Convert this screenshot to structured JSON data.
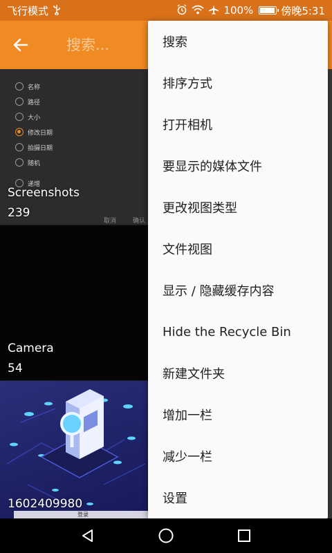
{
  "status": {
    "airplane_mode": "飞行模式",
    "usb_icon": "usb-icon",
    "battery": "100%",
    "battery_level": 1.0,
    "time": "傍晚5:31",
    "icons": [
      "alarm-icon",
      "wifi-icon",
      "airplane-icon"
    ]
  },
  "appbar": {
    "search_placeholder": "搜索...",
    "back_icon": "arrow-left-icon"
  },
  "colors": {
    "status_bar": "#d9711a",
    "app_bar": "#f08a23",
    "accent": "#f08a23",
    "menu_bg": "#fafafa"
  },
  "folders": [
    {
      "name": "Screenshots",
      "count": "239"
    },
    {
      "name": "Camera",
      "count": "54"
    },
    {
      "name": "1602409980",
      "count": ""
    }
  ],
  "sort_thumb": {
    "options": [
      "名称",
      "路径",
      "大小",
      "修改日期",
      "拍摄日期",
      "随机"
    ],
    "selected": "修改日期",
    "extra": "递增",
    "cancel": "取消",
    "ok": "确认"
  },
  "login_thumb": {
    "button": "登录"
  },
  "menu": {
    "items": [
      "搜索",
      "排序方式",
      "打开相机",
      "要显示的媒体文件",
      "更改视图类型",
      "文件视图",
      "显示 / 隐藏缓存内容",
      "Hide the Recycle Bin",
      "新建文件夹",
      "增加一栏",
      "减少一栏",
      "设置"
    ]
  },
  "navbar": {
    "icons": [
      "back-triangle-icon",
      "home-circle-icon",
      "recents-square-icon"
    ]
  }
}
